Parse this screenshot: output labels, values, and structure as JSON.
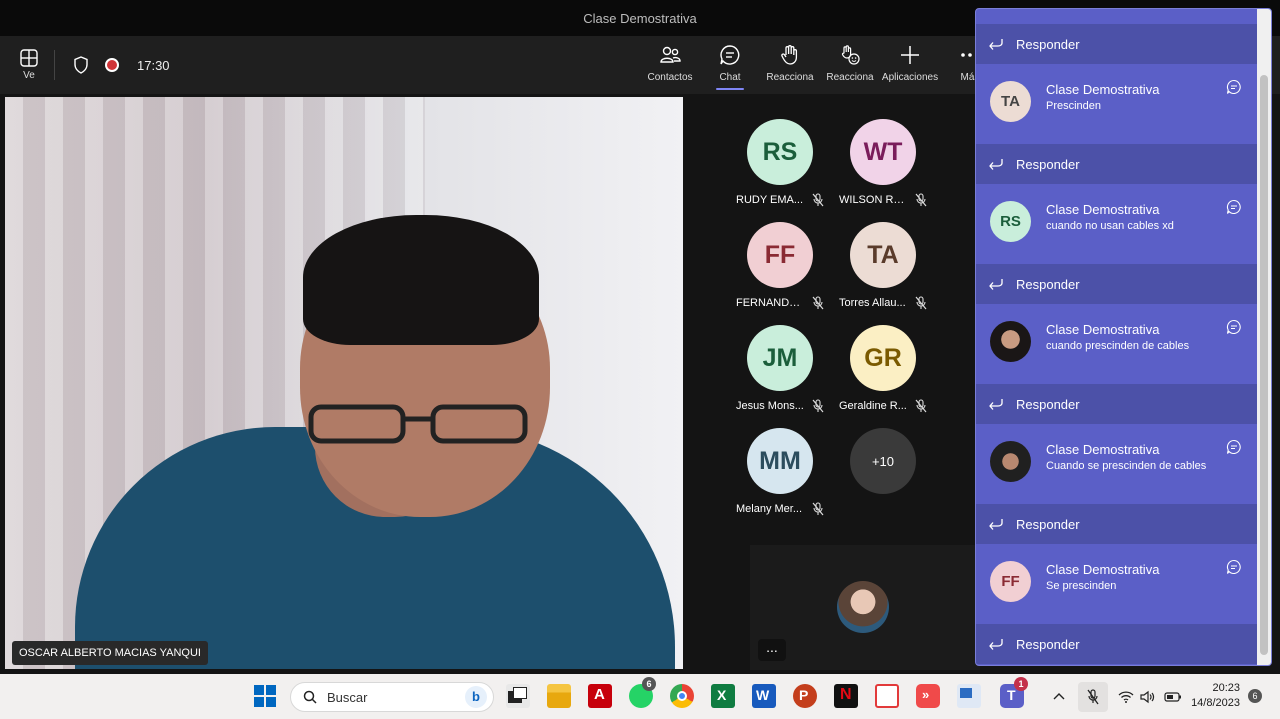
{
  "window": {
    "title": "Clase Demostrativa"
  },
  "toolbar": {
    "view_label": "Ve",
    "timer": "17:30",
    "buttons": [
      {
        "label": "Contactos",
        "icon": "people-icon"
      },
      {
        "label": "Chat",
        "icon": "chat-icon"
      },
      {
        "label": "Reacciona",
        "icon": "raise-hand-icon"
      },
      {
        "label": "Reacciona",
        "icon": "reaction-icon"
      },
      {
        "label": "Aplicaciones",
        "icon": "plus-icon"
      },
      {
        "label": "Más",
        "icon": "more-icon"
      }
    ]
  },
  "main_video": {
    "name": "OSCAR ALBERTO MACIAS YANQUI"
  },
  "gallery": {
    "participants": [
      {
        "initials": "RS",
        "name": "RUDY EMA...",
        "bg": "#c9eedb",
        "fg": "#1b5e3b"
      },
      {
        "initials": "WT",
        "name": "WILSON RO...",
        "bg": "#f1d3e8",
        "fg": "#7a1d5b"
      },
      {
        "initials": "FF",
        "name": "FERNANDO...",
        "bg": "#f1cfd3",
        "fg": "#8a2a33"
      },
      {
        "initials": "TA",
        "name": "Torres Allau...",
        "bg": "#ecdcd4",
        "fg": "#5a3b2b"
      },
      {
        "initials": "JM",
        "name": "Jesus Mons...",
        "bg": "#c9eedb",
        "fg": "#1b5e3b"
      },
      {
        "initials": "GR",
        "name": "Geraldine R...",
        "bg": "#fbefc4",
        "fg": "#7a5a00"
      },
      {
        "initials": "MM",
        "name": "Melany Mer...",
        "bg": "#d6e6ef",
        "fg": "#2c4d5e"
      }
    ],
    "overflow": "+10"
  },
  "self_view": {
    "more": "..."
  },
  "chat": {
    "reply_label": "Responder",
    "messages": [
      {
        "initials": "TA",
        "avatar_bg": "#ecdcd4",
        "title": "Clase Demostrativa",
        "text": "Prescinden"
      },
      {
        "initials": "RS",
        "avatar_bg": "#c9eedb",
        "title": "Clase Demostrativa",
        "text": "cuando no usan cables xd"
      },
      {
        "initials": "",
        "avatar_bg": "photo",
        "title": "Clase Demostrativa",
        "text": "cuando prescinden de cables"
      },
      {
        "initials": "",
        "avatar_bg": "photo",
        "title": "Clase Demostrativa",
        "text": "Cuando se prescinden de cables"
      },
      {
        "initials": "FF",
        "avatar_bg": "#f1cfd3",
        "title": "Clase Demostrativa",
        "text": "Se prescinden"
      }
    ]
  },
  "taskbar": {
    "search_placeholder": "Buscar",
    "whatsapp_badge": "6",
    "teams_badge": "1",
    "time": "20:23",
    "date": "14/8/2023",
    "notifications": "6"
  }
}
